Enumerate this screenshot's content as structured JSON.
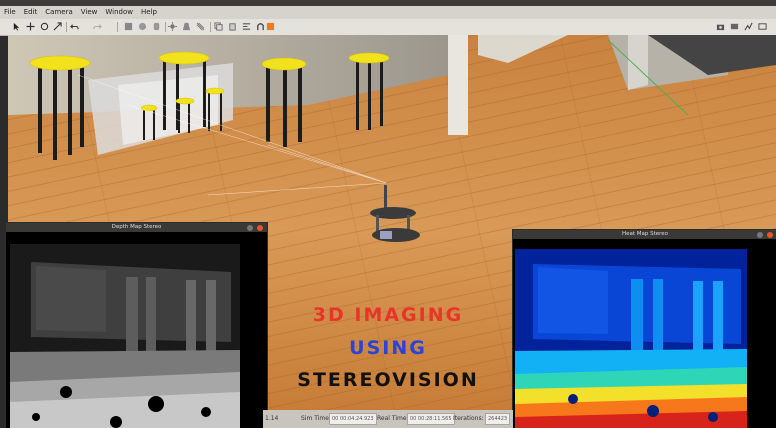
{
  "menu": [
    "File",
    "Edit",
    "Camera",
    "View",
    "Window",
    "Help"
  ],
  "depth_window": {
    "title": "Depth Map Stereo"
  },
  "heat_window": {
    "title": "Heat Map Stereo"
  },
  "overlay": {
    "line1": "3D IMAGING",
    "line2": "USING",
    "line3": "STEREOVISION",
    "line1_color": "#e8352a",
    "line2_color": "#2a43d8",
    "line3_color": "#111111"
  },
  "status": {
    "left_value": "1.14",
    "sim_time_label": "Sim Time:",
    "sim_time_value": "00 00:04:24.923",
    "real_time_label": "Real Time:",
    "real_time_value": "00 00:28:11.565",
    "iterations_label": "Iterations:",
    "iterations_value": "264423"
  },
  "icons": [
    "select-icon",
    "translate-icon",
    "rotate-icon",
    "scale-icon",
    "undo-icon",
    "redo-icon",
    "box-icon",
    "sphere-icon",
    "cylinder-icon",
    "sun-icon",
    "spotlight-icon",
    "directional-light-icon",
    "copy-icon",
    "paste-icon",
    "align-icon",
    "snap-icon",
    "magnet-icon",
    "orange-square-icon",
    "screenshot-icon",
    "record-icon",
    "plot-icon",
    "video-icon"
  ]
}
